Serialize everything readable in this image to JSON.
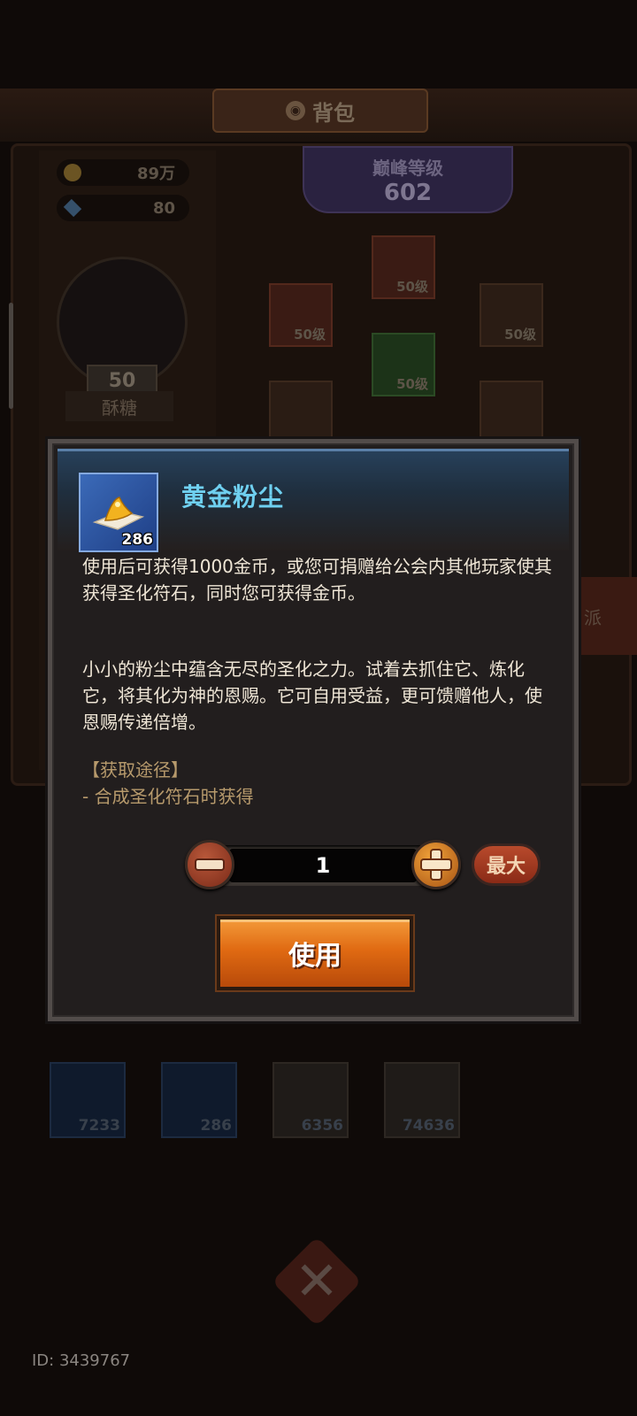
{
  "background": {
    "title": "背包",
    "gold": "89万",
    "gems": "80",
    "peak_level_label": "巅峰等级",
    "peak_level_value": "602",
    "char_level": "50",
    "char_name": "酥糖",
    "equip_levels": [
      "50级",
      "50级",
      "50级",
      "50级"
    ],
    "side_label": "派",
    "inventory_counts": [
      "7233",
      "286",
      "6356",
      "74636"
    ]
  },
  "item": {
    "name": "黄金粉尘",
    "count": "286",
    "desc1": "使用后可获得1000金币，或您可捐赠给公会内其他玩家使其获得圣化符石，同时您可获得金币。",
    "desc2": "小小的粉尘中蕴含无尽的圣化之力。试着去抓住它、炼化它，将其化为神的恩赐。它可自用受益，更可馈赠他人，使恩赐传递倍增。",
    "source_title": "【获取途径】",
    "source_item": "- 合成圣化符石时获得",
    "icon": "gold-dust-icon",
    "name_color": "#6fd0f0"
  },
  "quantity": {
    "value": "1",
    "max_label": "最大"
  },
  "use_button": "使用",
  "footer": {
    "user_id": "ID: 3439767"
  },
  "colors": {
    "accent": "#e06a12",
    "modal_bg": "#221e1e",
    "source_text": "#b79a6c"
  }
}
